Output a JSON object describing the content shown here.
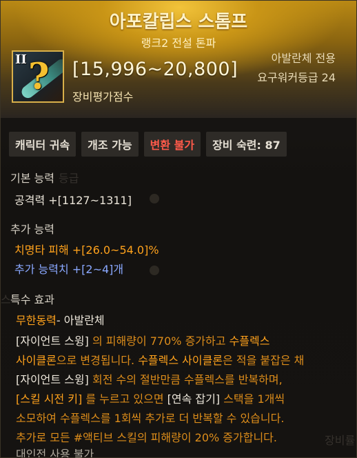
{
  "item": {
    "name": "아포칼립스 스톰프",
    "rank": "랭크2 전설 톤파",
    "tier": "II",
    "score": "[15,996~20,800]",
    "score_label": "장비평가점수",
    "class_only": "아발란체 전용",
    "req_level": "요구워커등급 24"
  },
  "badges": [
    {
      "label": "캐릭터 귀속"
    },
    {
      "label": "개조 가능"
    },
    {
      "label": "변환 불가"
    },
    {
      "label": "장비 숙련: 87"
    }
  ],
  "basic": {
    "title": "기본 능력",
    "attack": "공격력  +[1127~1311]"
  },
  "extra": {
    "title": "추가 능력",
    "crit": "치명타 피해  +[26.0~54.0]%",
    "count": "추가 능력치 +[2~4]개"
  },
  "special": {
    "title": "특수 효과",
    "name": "무한동력",
    "class": "- 아발란체",
    "l1a": "[자이언트 스윙] ",
    "l1b": "의 피해량이 770% 증가하고 ",
    "l1c": "수플렉스",
    "l2a": "사이클론",
    "l2b": "으로 변경됩니다. ",
    "l2c": "수플렉스 사이클론",
    "l2d": "은 적을 붙잡은 채",
    "l3a": "[자이언트 스윙] ",
    "l3b": "회전 수의 절반만큼 수플렉스를 반복하며,",
    "l4a": "[스킬 시전 키] ",
    "l4b": "를 누르고 있으면 ",
    "l4c": "[연속 잡기] ",
    "l4d": "스택을 1개씩",
    "l5": "소모하여 수플렉스를 1회씩 추가로 더 반복할 수 있습니다.",
    "l6": "추가로 모든 #액티브 스킬의 피해량이 20% 증가합니다.",
    "l7": "대인전 사용 불가"
  },
  "background": {
    "ghost1": "등급",
    "ghost2": "스",
    "ghost3": "장비률"
  }
}
